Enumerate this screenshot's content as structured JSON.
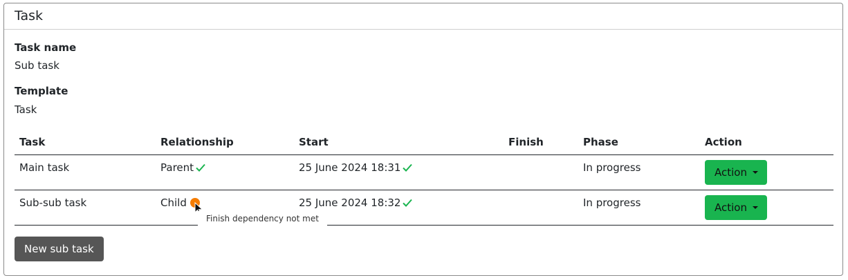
{
  "card": {
    "title": "Task"
  },
  "fields": {
    "task_name_label": "Task name",
    "task_name_value": "Sub task",
    "template_label": "Template",
    "template_value": "Task"
  },
  "table": {
    "headers": [
      "Task",
      "Relationship",
      "Start",
      "Finish",
      "Phase",
      "Action"
    ],
    "rows": [
      {
        "task": "Main task",
        "relationship": "Parent",
        "relationship_status": "check-icon",
        "start": "25 June 2024 18:31",
        "start_status": "check-icon",
        "finish": "",
        "phase": "In progress",
        "action": "Action"
      },
      {
        "task": "Sub-sub task",
        "relationship": "Child",
        "relationship_status": "warning-icon",
        "start": "25 June 2024 18:32",
        "start_status": "check-icon",
        "finish": "",
        "phase": "In progress",
        "action": "Action"
      }
    ]
  },
  "tooltip": {
    "text": "Finish dependency not met"
  },
  "buttons": {
    "new_sub_task": "New sub task"
  },
  "colors": {
    "success": "#19b44f",
    "warning": "#f57c00",
    "secondary": "#565656"
  }
}
